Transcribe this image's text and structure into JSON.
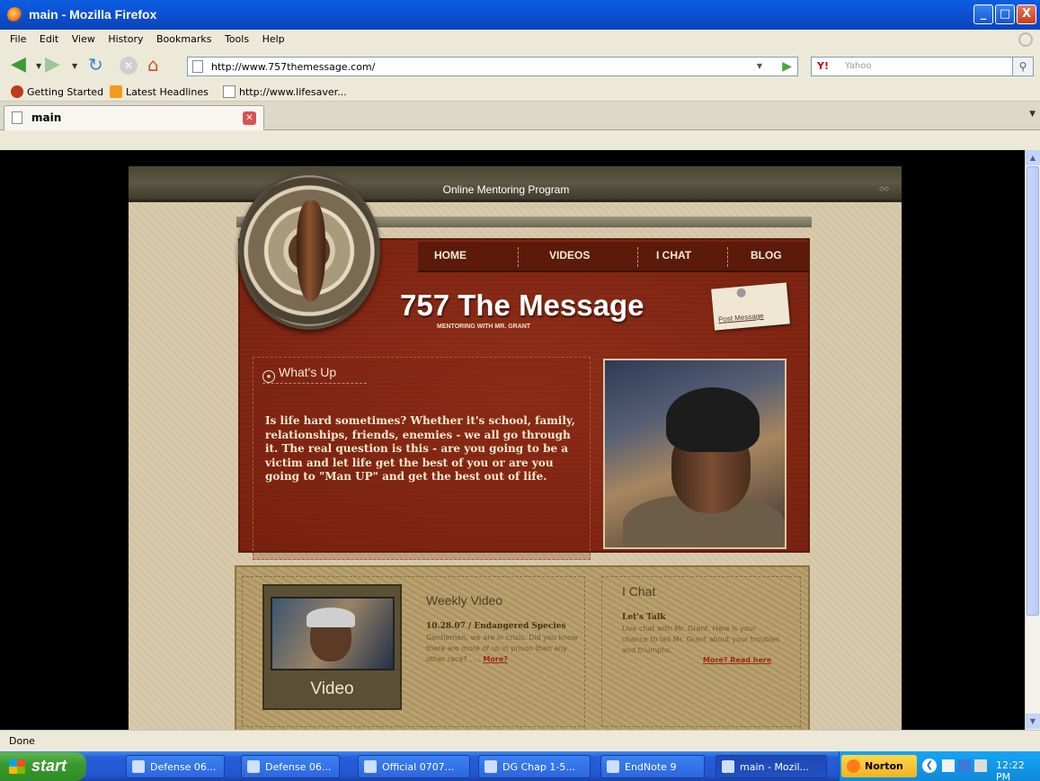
{
  "window": {
    "title": "main - Mozilla Firefox",
    "controls": {
      "minimize": "_",
      "maximize": "□",
      "close": "X"
    }
  },
  "menu": [
    "File",
    "Edit",
    "View",
    "History",
    "Bookmarks",
    "Tools",
    "Help"
  ],
  "toolbar": {
    "url": "http://www.757themessage.com/",
    "search_placeholder": "Yahoo",
    "search_engine": "Y!"
  },
  "bookmarks": [
    {
      "label": "Getting Started",
      "icon": "firefox-icon"
    },
    {
      "label": "Latest Headlines",
      "icon": "rss-icon"
    },
    {
      "label": "http://www.lifesaver...",
      "icon": "page-icon"
    }
  ],
  "tab": {
    "label": "main"
  },
  "site": {
    "banner": "Online Mentoring Program",
    "nav": [
      "HOME",
      "VIDEOS",
      "I CHAT",
      "BLOG"
    ],
    "headline": "757 The Message",
    "subheadline": "MENTORING WITH MR. GRANT",
    "post_message": "Post Message",
    "whats_up_title": "What's Up",
    "whats_up_body": "Is life hard sometimes? Whether it's  school, family, relationships, friends, enemies - we all go through it. The real question is this - are you going to be a victim and let life get the best of you or  are you going to \"Man UP\" and get the best out of life.",
    "video_label": "Video",
    "weekly_video_title": "Weekly Video",
    "weekly_video_date": "10.28.07 / Endangered Species",
    "weekly_video_desc": "Gentlemen, we are in crisis.  Did you know there are more of us in prison than any other race? . . . ",
    "weekly_video_more": "More?",
    "chat_title": "I Chat",
    "chat_sub": "Let's Talk",
    "chat_desc": "Live chat with Mr. Grant.  Here is your chance to tell Mr. Grant about your troubles and triumphs.",
    "chat_more": "More? Read here"
  },
  "status": "Done",
  "taskbar": {
    "start": "start",
    "tasks": [
      "Defense 06...",
      "Defense 06...",
      "Official 0707...",
      "DG Chap 1-5...",
      "EndNote 9",
      "main - Mozil..."
    ],
    "norton": "Norton",
    "clock": "12:22 PM"
  }
}
